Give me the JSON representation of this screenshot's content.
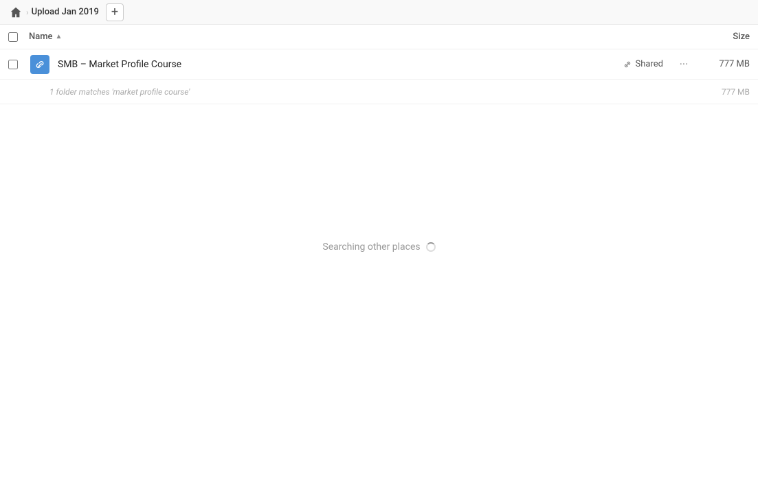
{
  "header": {
    "home_icon": "home-icon",
    "breadcrumb_title": "Upload Jan 2019",
    "add_button_label": "+"
  },
  "columns": {
    "name_label": "Name",
    "sort_indicator": "▲",
    "size_label": "Size"
  },
  "file_row": {
    "file_name": "SMB – Market Profile Course",
    "shared_label": "Shared",
    "more_icon": "more-options-icon",
    "file_size": "777 MB"
  },
  "sub_info": {
    "text": "1 folder matches 'market profile course'",
    "size": "777 MB"
  },
  "searching": {
    "text": "Searching other places"
  }
}
